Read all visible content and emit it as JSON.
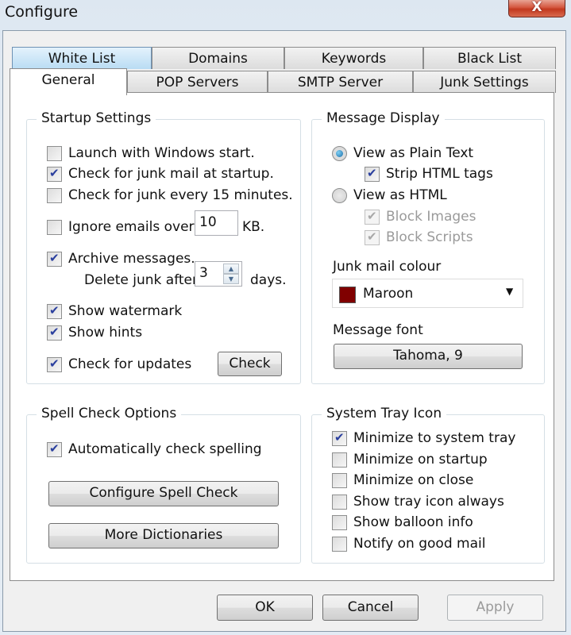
{
  "window": {
    "title": "Configure",
    "close_label": "X"
  },
  "tabs_back": [
    {
      "label": "White List",
      "highlighted": true
    },
    {
      "label": "Domains"
    },
    {
      "label": "Keywords"
    },
    {
      "label": "Black List"
    }
  ],
  "tabs_front": [
    {
      "label": "General",
      "active": true
    },
    {
      "label": "POP Servers"
    },
    {
      "label": "SMTP Server"
    },
    {
      "label": "Junk Settings"
    }
  ],
  "startup": {
    "title": "Startup Settings",
    "launch": {
      "label": "Launch with Windows start.",
      "checked": false
    },
    "check_startup": {
      "label": "Check for junk mail at startup.",
      "checked": true
    },
    "check_every": {
      "label": "Check for junk every 15 minutes.",
      "checked": false
    },
    "ignore": {
      "label": "Ignore emails over",
      "checked": false,
      "value": "10",
      "unit": "KB."
    },
    "archive": {
      "label": "Archive messages.",
      "checked": true
    },
    "delete_after": {
      "label": "Delete junk after",
      "value": "3",
      "unit": "days."
    },
    "watermark": {
      "label": "Show watermark",
      "checked": true
    },
    "hints": {
      "label": "Show hints",
      "checked": true
    },
    "updates": {
      "label": "Check for updates",
      "checked": true
    },
    "check_button": "Check"
  },
  "display": {
    "title": "Message Display",
    "plain": {
      "label": "View as Plain Text",
      "selected": true
    },
    "strip": {
      "label": "Strip HTML tags",
      "checked": true
    },
    "html": {
      "label": "View as HTML",
      "selected": false
    },
    "block_images": {
      "label": "Block Images",
      "checked": true,
      "disabled": true
    },
    "block_scripts": {
      "label": "Block Scripts",
      "checked": true,
      "disabled": true
    },
    "colour_label": "Junk mail colour",
    "colour_value": "Maroon",
    "colour_hex": "#800000",
    "font_label": "Message font",
    "font_button": "Tahoma, 9"
  },
  "spell": {
    "title": "Spell Check Options",
    "auto": {
      "label": "Automatically check spelling",
      "checked": true
    },
    "configure_button": "Configure Spell Check",
    "dictionaries_button": "More Dictionaries"
  },
  "tray": {
    "title": "System Tray Icon",
    "items": [
      {
        "label": "Minimize to system tray",
        "checked": true
      },
      {
        "label": "Minimize on startup",
        "checked": false
      },
      {
        "label": "Minimize on close",
        "checked": false
      },
      {
        "label": "Show tray icon always",
        "checked": false
      },
      {
        "label": "Show balloon info",
        "checked": false
      },
      {
        "label": "Notify on good mail",
        "checked": false
      }
    ]
  },
  "footer": {
    "ok": "OK",
    "cancel": "Cancel",
    "apply": "Apply"
  }
}
